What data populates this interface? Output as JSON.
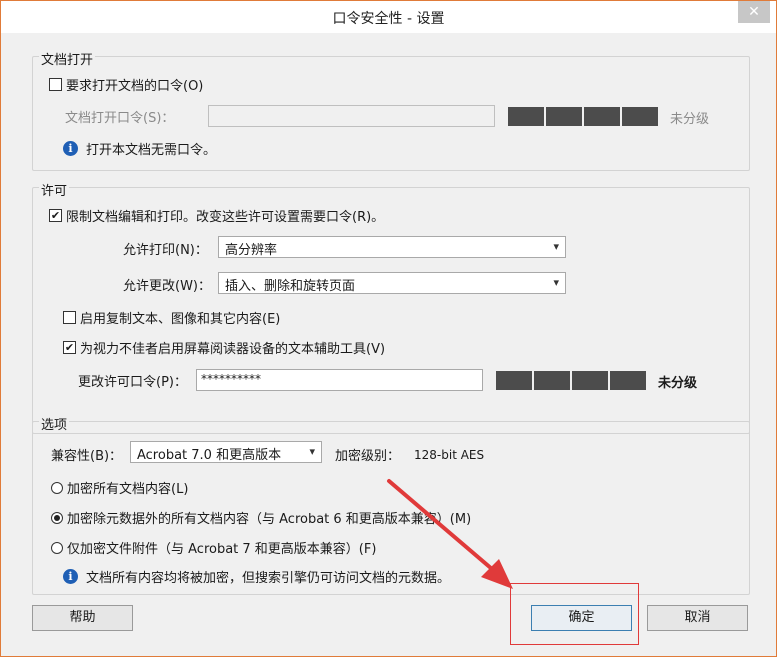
{
  "window": {
    "title": "口令安全性 - 设置",
    "close_glyph": "✕"
  },
  "doc_open": {
    "group_title": "文档打开",
    "require_password": {
      "label": "要求打开文档的口令(O)",
      "checked": false
    },
    "password_label": "文档打开口令(S)：",
    "password_value": "",
    "strength_text": "未分级",
    "info_text": "打开本文档无需口令。"
  },
  "permissions": {
    "group_title": "许可",
    "restrict": {
      "label": "限制文档编辑和打印。改变这些许可设置需要口令(R)。",
      "checked": true
    },
    "print_label": "允许打印(N)：",
    "print_value": "高分辨率",
    "change_label": "允许更改(W)：",
    "change_value": "插入、删除和旋转页面",
    "copy": {
      "label": "启用复制文本、图像和其它内容(E)",
      "checked": false
    },
    "accessibility": {
      "label": "为视力不佳者启用屏幕阅读器设备的文本辅助工具(V)",
      "checked": true
    },
    "perm_password_label": "更改许可口令(P)：",
    "perm_password_value": "**********",
    "strength_text": "未分级"
  },
  "options": {
    "group_title": "选项",
    "compat_label": "兼容性(B)：",
    "compat_value": "Acrobat 7.0 和更高版本",
    "encrypt_level_label": "加密级别：",
    "encrypt_level_value": "128-bit AES",
    "radios": [
      {
        "label": "加密所有文档内容(L)",
        "selected": false
      },
      {
        "label": "加密除元数据外的所有文档内容（与 Acrobat 6 和更高版本兼容）(M)",
        "selected": true
      },
      {
        "label": "仅加密文件附件（与 Acrobat 7 和更高版本兼容）(F)",
        "selected": false
      }
    ],
    "info_text": "文档所有内容均将被加密，但搜索引擎仍可访问文档的元数据。"
  },
  "buttons": {
    "help": "帮助",
    "ok": "确定",
    "cancel": "取消"
  },
  "colors": {
    "annotation_red": "#e03a3a",
    "info_blue": "#1f5fb5",
    "strength_gray": "#4c4c4c"
  }
}
